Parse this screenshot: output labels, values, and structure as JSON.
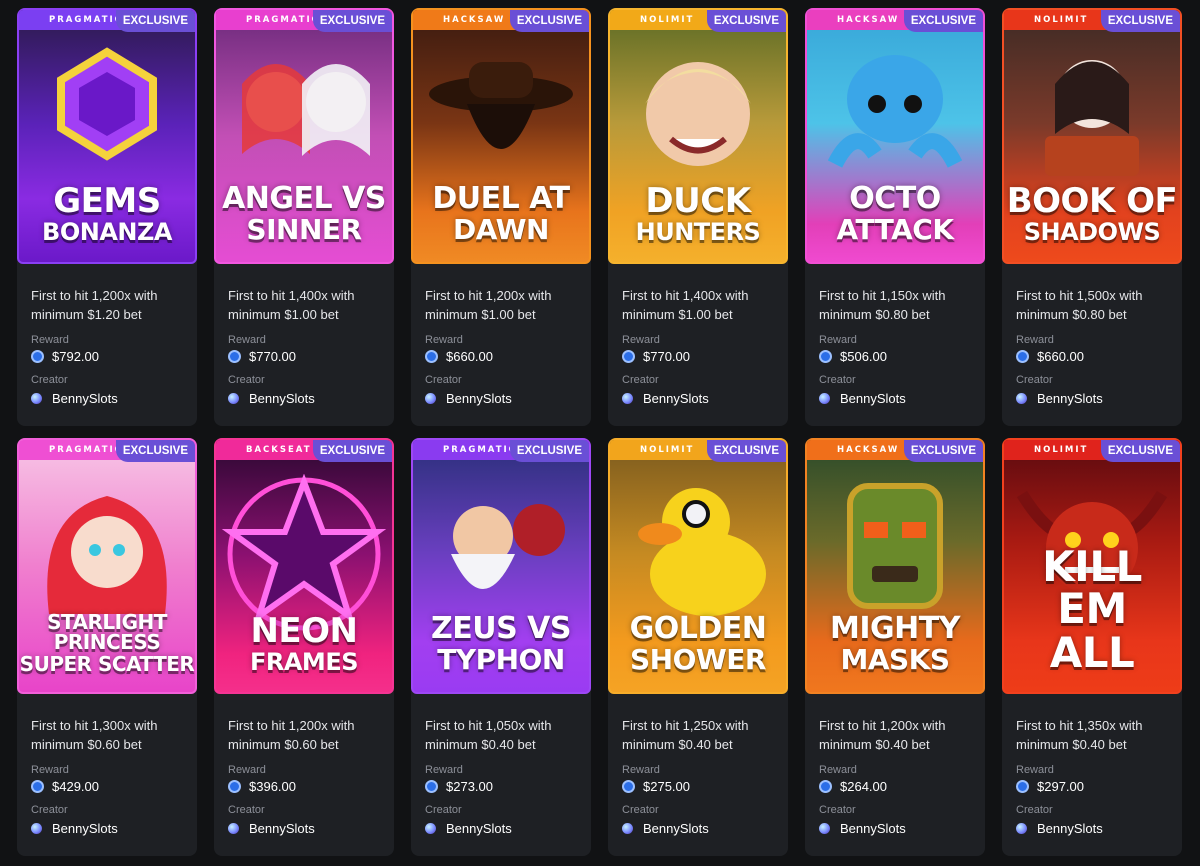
{
  "labels": {
    "reward": "Reward",
    "creator": "Creator"
  },
  "rows": [
    [
      {
        "provider": "PRAGMATIC PL",
        "banner": "#7b3ff2",
        "badge": "EXCLUSIVE",
        "t1": "GEMS",
        "t2": "BONANZA",
        "style": "t-mid",
        "bg": "linear-gradient(180deg,#2b1a4a 0%,#5a22b8 45%,#8a2be2 75%,#6b19c9 100%)",
        "border": "#8b3ff5",
        "art": "gem",
        "desc": "First to hit 1,200x with minimum $1.20 bet",
        "reward": "$792.00",
        "creator": "BennySlots"
      },
      {
        "provider": "PRAGMATIC PL",
        "banner": "#e83fcf",
        "badge": "EXCLUSIVE",
        "t1": "ANGEL VS",
        "t2": "SINNER",
        "style": "t-mid2",
        "bg": "linear-gradient(180deg,#6b2a7a 0%,#c24fb5 50%,#e54dd3 100%)",
        "border": "#f257e0",
        "art": "angel",
        "desc": "First to hit 1,400x with minimum $1.00 bet",
        "reward": "$770.00",
        "creator": "BennySlots"
      },
      {
        "provider": "HACKSAW",
        "banner": "#f07a18",
        "badge": "EXCLUSIVE",
        "t1": "DUEL AT",
        "t2": "DAWN",
        "style": "t-mid2",
        "bg": "linear-gradient(180deg,#3a1a10 0%,#7a3514 45%,#e8741c 80%,#f08a24 100%)",
        "border": "#f5921f",
        "art": "cowboy",
        "desc": "First to hit 1,200x with minimum $1.00 bet",
        "reward": "$660.00",
        "creator": "BennySlots"
      },
      {
        "provider": "NOLIMIT",
        "banner": "#f2a918",
        "badge": "EXCLUSIVE",
        "t1": "DUCK",
        "t2": "HUNTERS",
        "style": "t-mid",
        "bg": "linear-gradient(180deg,#5c6b25 0%,#b89a3a 45%,#f0a224 80%,#f5b02c 100%)",
        "border": "#f7b52e",
        "art": "face",
        "desc": "First to hit 1,400x with minimum $1.00 bet",
        "reward": "$770.00",
        "creator": "BennySlots"
      },
      {
        "provider": "HACKSAW",
        "banner": "#ea3fbf",
        "badge": "EXCLUSIVE",
        "t1": "OCTO",
        "t2": "ATTACK",
        "style": "t-mid2",
        "bg": "linear-gradient(180deg,#37a6d8 0%,#4dc3e8 45%,#e23fb8 85%,#f04ad0 100%)",
        "border": "#f24fd5",
        "art": "octo",
        "desc": "First to hit 1,150x with minimum $0.80 bet",
        "reward": "$506.00",
        "creator": "BennySlots"
      },
      {
        "provider": "NOLIMIT",
        "banner": "#e8361a",
        "badge": "EXCLUSIVE",
        "t1": "BOOK OF",
        "t2": "SHADOWS",
        "style": "t-mid",
        "bg": "linear-gradient(180deg,#3d2a25 0%,#7a3a2a 45%,#e2421e 80%,#ee4a1c 100%)",
        "border": "#f24f24",
        "art": "book",
        "desc": "First to hit 1,500x with minimum $0.80 bet",
        "reward": "$660.00",
        "creator": "BennySlots"
      }
    ],
    [
      {
        "provider": "PRAGMATIC PL",
        "banner": "#ef4fd3",
        "badge": "EXCLUSIVE",
        "t1": "STARLIGHT PRINCESS",
        "t2": "SUPER SCATTER",
        "style": "t-small",
        "bg": "linear-gradient(180deg,#f7c6e6 0%,#f07fce 50%,#e844c9 100%)",
        "border": "#f25fd9",
        "art": "princess",
        "desc": "First to hit 1,300x with minimum $0.60 bet",
        "reward": "$429.00",
        "creator": "BennySlots"
      },
      {
        "provider": "BACKSEAT GAM",
        "banner": "#f02a9a",
        "badge": "EXCLUSIVE",
        "t1": "NEON",
        "t2": "FRAMES",
        "style": "t-mid",
        "bg": "linear-gradient(180deg,#2a0830 0%,#8a1070 45%,#f0237f 85%,#f52f8b 100%)",
        "border": "#f53494",
        "art": "star",
        "desc": "First to hit 1,200x with minimum $0.60 bet",
        "reward": "$396.00",
        "creator": "BennySlots"
      },
      {
        "provider": "PRAGMATIC PL",
        "banner": "#8a3bf0",
        "badge": "EXCLUSIVE",
        "t1": "ZEUS VS",
        "t2": "TYPHON",
        "style": "t-mid2",
        "bg": "linear-gradient(180deg,#2a2f7a 0%,#6a3fc0 45%,#a23ff0 80%,#9a3bf2 100%)",
        "border": "#9e48f5",
        "art": "zeus",
        "desc": "First to hit 1,050x with minimum $0.40 bet",
        "reward": "$273.00",
        "creator": "BennySlots"
      },
      {
        "provider": "NOLIMIT",
        "banner": "#f2a51c",
        "badge": "EXCLUSIVE",
        "t1": "GOLDEN",
        "t2": "SHOWER",
        "style": "t-mid2",
        "bg": "linear-gradient(180deg,#7a5a1e 0%,#c58a22 45%,#f39a1e 80%,#f5a324 100%)",
        "border": "#f7ad2a",
        "art": "duck",
        "desc": "First to hit 1,250x with minimum $0.40 bet",
        "reward": "$275.00",
        "creator": "BennySlots"
      },
      {
        "provider": "HACKSAW",
        "banner": "#f06f1a",
        "badge": "EXCLUSIVE",
        "t1": "MIGHTY",
        "t2": "MASKS",
        "style": "t-mid2",
        "bg": "linear-gradient(180deg,#2a4a2a 0%,#6a6a2a 40%,#e86a1c 80%,#f0771e 100%)",
        "border": "#f28222",
        "art": "mask",
        "desc": "First to hit 1,200x with minimum $0.40 bet",
        "reward": "$264.00",
        "creator": "BennySlots"
      },
      {
        "provider": "NOLIMIT",
        "banner": "#e0231c",
        "badge": "EXCLUSIVE",
        "t1": "KILL EM",
        "t2": "ALL",
        "style": "t-big",
        "bg": "linear-gradient(180deg,#5a0a10 0%,#a81a12 40%,#e8361a 80%,#ee3c18 100%)",
        "border": "#f2401e",
        "art": "demon",
        "desc": "First to hit 1,350x with minimum $0.40 bet",
        "reward": "$297.00",
        "creator": "BennySlots"
      }
    ]
  ]
}
